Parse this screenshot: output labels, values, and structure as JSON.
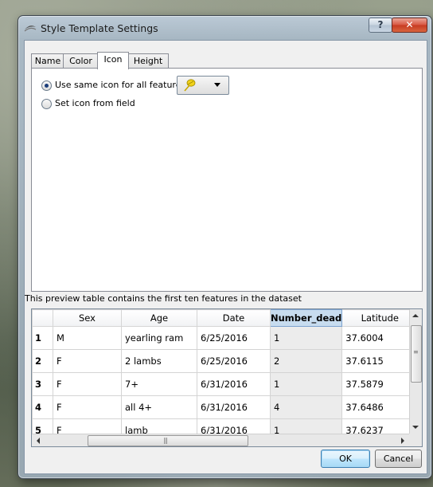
{
  "window": {
    "title": "Style Template Settings",
    "help_label": "?",
    "close_label": "✕"
  },
  "tabs": [
    {
      "label": "Name",
      "active": false
    },
    {
      "label": "Color",
      "active": false
    },
    {
      "label": "Icon",
      "active": true
    },
    {
      "label": "Height",
      "active": false
    }
  ],
  "icon_tab": {
    "option_same_icon": "Use same icon for all features",
    "option_from_field": "Set icon from field",
    "selected_option": "same_icon",
    "selected_icon": "yellow-pushpin-icon"
  },
  "preview": {
    "caption": "This preview table contains the first ten features in the dataset",
    "columns": [
      "Sex",
      "Age",
      "Date",
      "Number_dead",
      "Latitude"
    ],
    "selected_column": "Number_dead",
    "rows": [
      {
        "num": "1",
        "cells": [
          "M",
          "yearling ram",
          "6/25/2016",
          "1",
          "37.6004"
        ]
      },
      {
        "num": "2",
        "cells": [
          "F",
          "2 lambs",
          "6/25/2016",
          "2",
          "37.6115"
        ]
      },
      {
        "num": "3",
        "cells": [
          "F",
          "7+",
          "6/31/2016",
          "1",
          "37.5879"
        ]
      },
      {
        "num": "4",
        "cells": [
          "F",
          "all 4+",
          "6/31/2016",
          "4",
          "37.6486"
        ]
      },
      {
        "num": "5",
        "cells": [
          "F",
          "lamb",
          "6/31/2016",
          "1",
          "37.6237"
        ]
      }
    ]
  },
  "buttons": {
    "ok": "OK",
    "cancel": "Cancel"
  },
  "colors": {
    "selected_column_header": "#c7dcef",
    "close_button": "#c63a22"
  }
}
